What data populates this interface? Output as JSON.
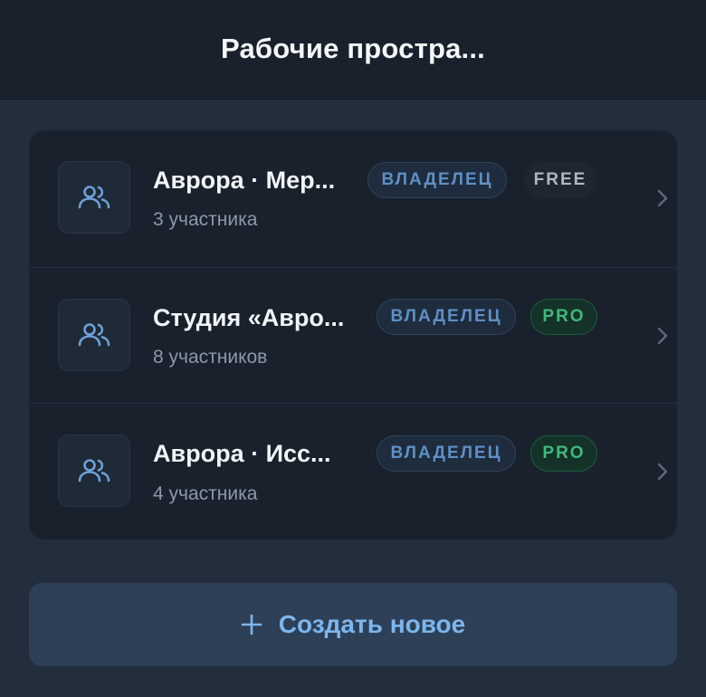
{
  "header": {
    "title": "Рабочие простра..."
  },
  "workspaces": [
    {
      "name": "Аврора · Мер...",
      "members": "3 участника",
      "role_badge": "ВЛАДЕЛЕЦ",
      "plan_badge": "FREE",
      "plan": "free",
      "icon": "users-icon"
    },
    {
      "name": "Студия «Авро...",
      "members": "8 участников",
      "role_badge": "ВЛАДЕЛЕЦ",
      "plan_badge": "PRO",
      "plan": "pro",
      "icon": "users-icon"
    },
    {
      "name": "Аврора · Исс...",
      "members": "4 участника",
      "role_badge": "ВЛАДЕЛЕЦ",
      "plan_badge": "PRO",
      "plan": "pro",
      "icon": "users-icon"
    }
  ],
  "create_button": {
    "icon": "plus-icon",
    "label": "Создать новое"
  },
  "colors": {
    "background": "#222e3c",
    "header": "#18212c",
    "card": "#18212c",
    "accent": "#7db6ee",
    "owner_badge": "#5f8fc6",
    "pro_badge": "#3fba7a",
    "free_badge": "#aeb8c3"
  }
}
